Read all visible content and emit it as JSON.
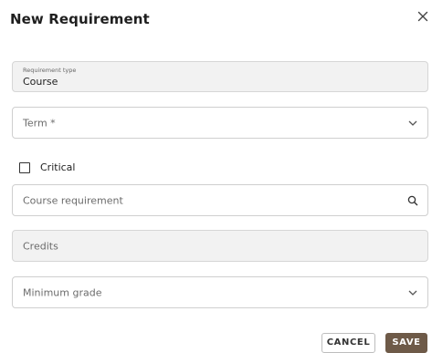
{
  "dialog": {
    "title": "New Requirement"
  },
  "requirement_type": {
    "label": "Requirement type",
    "value": "Course"
  },
  "term": {
    "placeholder": "Term *"
  },
  "critical": {
    "label": "Critical",
    "checked": false
  },
  "course_requirement": {
    "placeholder": "Course requirement"
  },
  "credits": {
    "placeholder": "Credits"
  },
  "minimum_grade": {
    "placeholder": "Minimum grade"
  },
  "actions": {
    "cancel_label": "CANCEL",
    "save_label": "SAVE"
  },
  "colors": {
    "save_button": "#6e5a48",
    "disabled_field": "#f2f2f2"
  },
  "icons": {
    "close": "close-icon",
    "dropdown": "chevron-down-icon",
    "search": "search-icon"
  }
}
